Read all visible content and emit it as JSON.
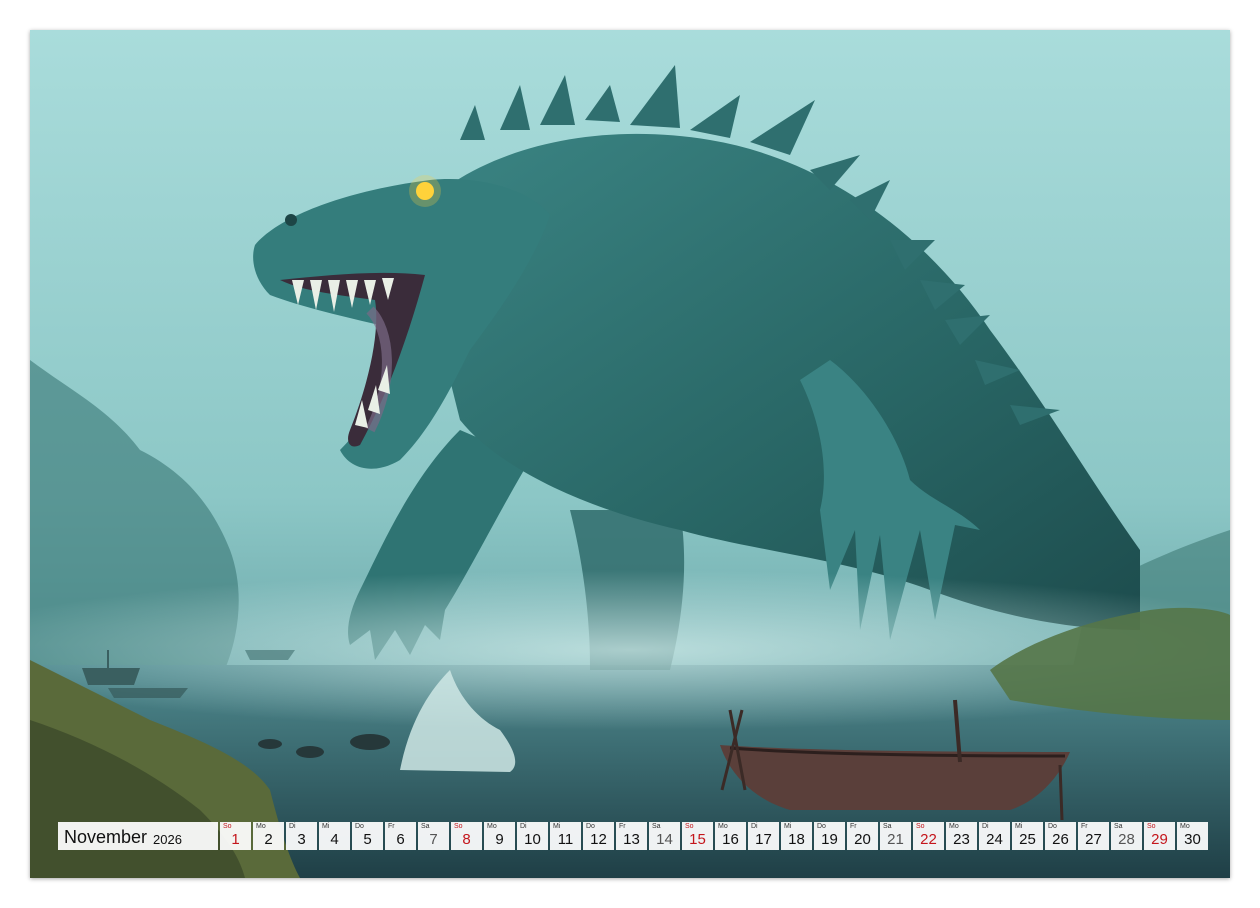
{
  "calendar": {
    "month": "November",
    "year": "2026",
    "days": [
      {
        "wd": "So",
        "n": "1",
        "type": "sun"
      },
      {
        "wd": "Mo",
        "n": "2",
        "type": "weekday"
      },
      {
        "wd": "Di",
        "n": "3",
        "type": "weekday"
      },
      {
        "wd": "Mi",
        "n": "4",
        "type": "weekday"
      },
      {
        "wd": "Do",
        "n": "5",
        "type": "weekday"
      },
      {
        "wd": "Fr",
        "n": "6",
        "type": "weekday"
      },
      {
        "wd": "Sa",
        "n": "7",
        "type": "sat"
      },
      {
        "wd": "So",
        "n": "8",
        "type": "sun"
      },
      {
        "wd": "Mo",
        "n": "9",
        "type": "weekday"
      },
      {
        "wd": "Di",
        "n": "10",
        "type": "weekday"
      },
      {
        "wd": "Mi",
        "n": "11",
        "type": "weekday"
      },
      {
        "wd": "Do",
        "n": "12",
        "type": "weekday"
      },
      {
        "wd": "Fr",
        "n": "13",
        "type": "weekday"
      },
      {
        "wd": "Sa",
        "n": "14",
        "type": "sat"
      },
      {
        "wd": "So",
        "n": "15",
        "type": "sun"
      },
      {
        "wd": "Mo",
        "n": "16",
        "type": "weekday"
      },
      {
        "wd": "Di",
        "n": "17",
        "type": "weekday"
      },
      {
        "wd": "Mi",
        "n": "18",
        "type": "weekday"
      },
      {
        "wd": "Do",
        "n": "19",
        "type": "weekday"
      },
      {
        "wd": "Fr",
        "n": "20",
        "type": "weekday"
      },
      {
        "wd": "Sa",
        "n": "21",
        "type": "sat"
      },
      {
        "wd": "So",
        "n": "22",
        "type": "sun"
      },
      {
        "wd": "Mo",
        "n": "23",
        "type": "weekday"
      },
      {
        "wd": "Di",
        "n": "24",
        "type": "weekday"
      },
      {
        "wd": "Mi",
        "n": "25",
        "type": "weekday"
      },
      {
        "wd": "Do",
        "n": "26",
        "type": "weekday"
      },
      {
        "wd": "Fr",
        "n": "27",
        "type": "weekday"
      },
      {
        "wd": "Sa",
        "n": "28",
        "type": "sat"
      },
      {
        "wd": "So",
        "n": "29",
        "type": "sun"
      },
      {
        "wd": "Mo",
        "n": "30",
        "type": "weekday"
      }
    ]
  },
  "colors": {
    "fog": "#9fd4d2",
    "creature": "#2e6f6e",
    "water": "#2f5b62",
    "sunday": "#c4161c",
    "eye": "#ffd23a"
  }
}
